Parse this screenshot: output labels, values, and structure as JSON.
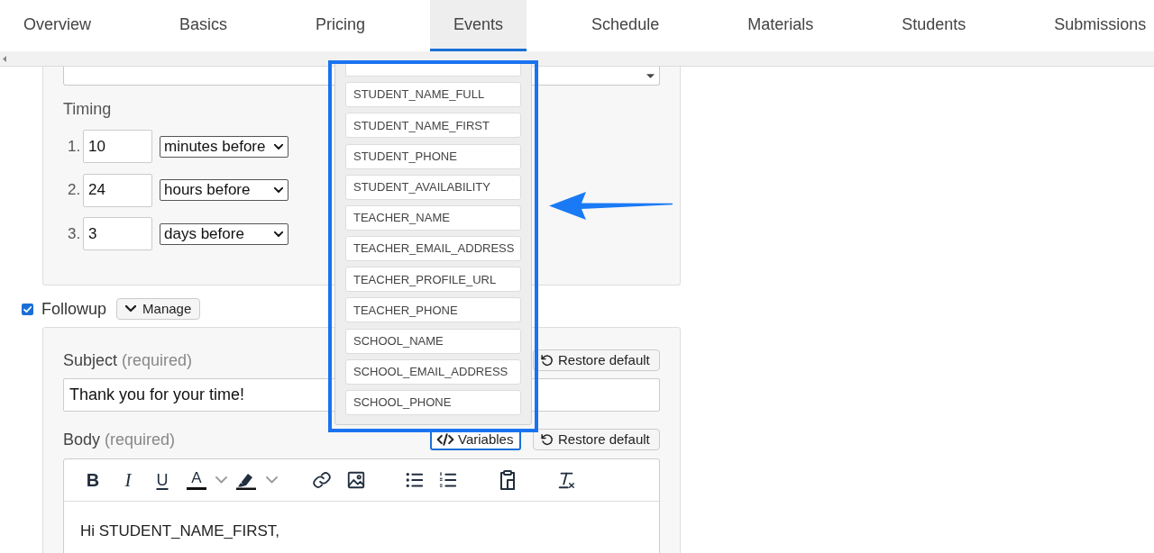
{
  "tabs": [
    {
      "label": "Overview",
      "selected": false
    },
    {
      "label": "Basics",
      "selected": false
    },
    {
      "label": "Pricing",
      "selected": false
    },
    {
      "label": "Events",
      "selected": true
    },
    {
      "label": "Schedule",
      "selected": false
    },
    {
      "label": "Materials",
      "selected": false
    },
    {
      "label": "Students",
      "selected": false
    },
    {
      "label": "Submissions",
      "selected": false
    }
  ],
  "reminder": {
    "timing_label": "Timing",
    "timings": [
      {
        "number": "1.",
        "amount": "10",
        "unit": "minutes before"
      },
      {
        "number": "2.",
        "amount": "24",
        "unit": "hours before"
      },
      {
        "number": "3.",
        "amount": "3",
        "unit": "days before"
      }
    ]
  },
  "followup": {
    "label": "Followup",
    "checked": true,
    "manage_button": "Manage",
    "subject": {
      "label": "Subject",
      "hint": "(required)",
      "value": "Thank you for your time!",
      "restore_button": "Restore default"
    },
    "body": {
      "label": "Body",
      "hint": "(required)",
      "variables_button": {
        "label": "Variables",
        "focused": true
      },
      "restore_button": "Restore default",
      "toolbar": {
        "bold": "B",
        "italic": "I",
        "underline": "U",
        "text_color": "A"
      },
      "content": "Hi STUDENT_NAME_FIRST,"
    }
  },
  "variables_menu": {
    "options": [
      "STUDENT_NAME_FULL",
      "STUDENT_NAME_FIRST",
      "STUDENT_PHONE",
      "STUDENT_AVAILABILITY",
      "TEACHER_NAME",
      "TEACHER_EMAIL_ADDRESS",
      "TEACHER_PROFILE_URL",
      "TEACHER_PHONE",
      "SCHOOL_NAME",
      "SCHOOL_EMAIL_ADDRESS",
      "SCHOOL_PHONE"
    ]
  }
}
